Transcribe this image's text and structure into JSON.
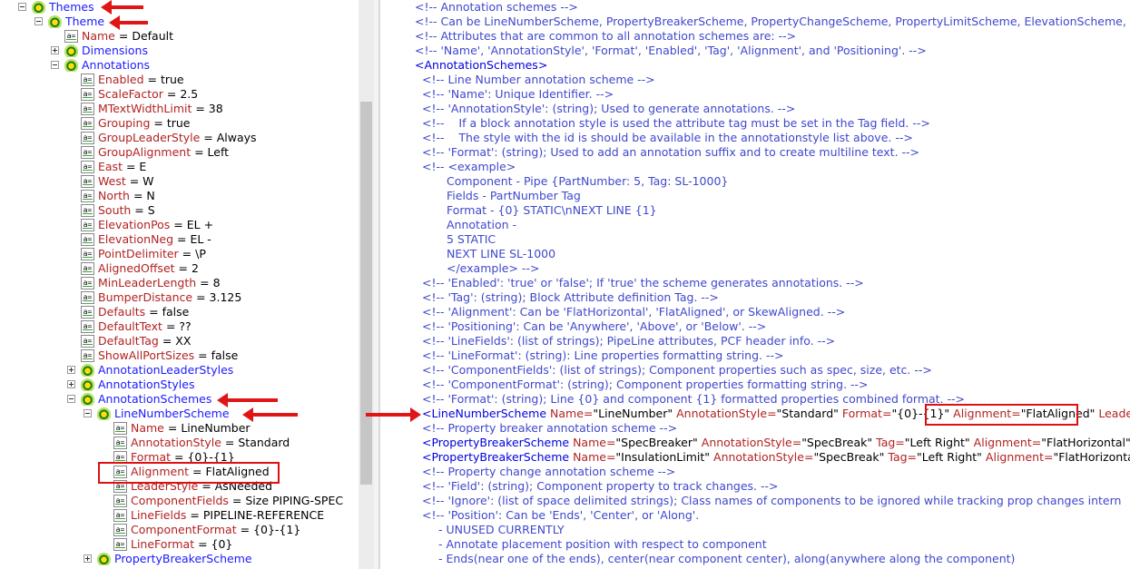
{
  "tree": {
    "root": "Themes",
    "theme": "Theme",
    "name_attr": "Name",
    "name_val": "Default",
    "dimensions": "Dimensions",
    "annotations": "Annotations",
    "annotation_attrs": [
      {
        "k": "Enabled",
        "v": "true"
      },
      {
        "k": "ScaleFactor",
        "v": "2.5"
      },
      {
        "k": "MTextWidthLimit",
        "v": "38"
      },
      {
        "k": "Grouping",
        "v": "true"
      },
      {
        "k": "GroupLeaderStyle",
        "v": "Always"
      },
      {
        "k": "GroupAlignment",
        "v": "Left"
      },
      {
        "k": "East",
        "v": "E"
      },
      {
        "k": "West",
        "v": "W"
      },
      {
        "k": "North",
        "v": "N"
      },
      {
        "k": "South",
        "v": "S"
      },
      {
        "k": "ElevationPos",
        "v": "EL +"
      },
      {
        "k": "ElevationNeg",
        "v": "EL -"
      },
      {
        "k": "PointDelimiter",
        "v": "\\P"
      },
      {
        "k": "AlignedOffset",
        "v": "2"
      },
      {
        "k": "MinLeaderLength",
        "v": "8"
      },
      {
        "k": "BumperDistance",
        "v": "3.125"
      },
      {
        "k": "Defaults",
        "v": "false"
      },
      {
        "k": "DefaultText",
        "v": "??"
      },
      {
        "k": "DefaultTag",
        "v": "XX"
      },
      {
        "k": "ShowAllPortSizes",
        "v": "false"
      }
    ],
    "annotation_leader_styles": "AnnotationLeaderStyles",
    "annotation_styles": "AnnotationStyles",
    "annotation_schemes": "AnnotationSchemes",
    "line_number_scheme": "LineNumberScheme",
    "scheme_attrs": [
      {
        "k": "Name",
        "v": "LineNumber"
      },
      {
        "k": "AnnotationStyle",
        "v": "Standard"
      },
      {
        "k": "Format",
        "v": "{0}-{1}"
      },
      {
        "k": "Alignment",
        "v": "FlatAligned"
      },
      {
        "k": "LeaderStyle",
        "v": "AsNeeded"
      },
      {
        "k": "ComponentFields",
        "v": "Size PIPING-SPEC"
      },
      {
        "k": "LineFields",
        "v": "PIPELINE-REFERENCE"
      },
      {
        "k": "ComponentFormat",
        "v": "{0}-{1}"
      },
      {
        "k": "LineFormat",
        "v": "{0}"
      }
    ],
    "property_breaker_scheme": "PropertyBreakerScheme"
  },
  "xml": {
    "l1": "<!-- Annotation schemes -->",
    "l2": "<!-- Can be LineNumberScheme, PropertyBreakerScheme, PropertyChangeScheme, PropertyLimitScheme, ElevationScheme, Co",
    "l3": "<!-- Attributes that are common to all annotation schemes are: -->",
    "l4": "<!-- 'Name', 'AnnotationStyle', 'Format', 'Enabled', 'Tag', 'Alignment', and 'Positioning'. -->",
    "l5": "<AnnotationSchemes>",
    "l6": "<!-- Line Number annotation scheme -->",
    "l7": "<!-- 'Name': Unique Identifier. -->",
    "l8": "<!-- 'AnnotationStyle': (string); Used to generate annotations. -->",
    "l9": "<!--    If a block annotation style is used the attribute tag must be set in the Tag field. -->",
    "l10": "<!--    The style with the id is should be available in the annotationstyle list above. -->",
    "l11": "<!-- 'Format': (string); Used to add an annotation suffix and to create multiline text. -->",
    "l12": "<!-- <example>",
    "l13": "Component - Pipe {PartNumber: 5, Tag: SL-1000}",
    "l14": "Fields - PartNumber Tag",
    "l15": "Format - {0} STATIC\\nNEXT LINE {1}",
    "l16": "Annotation -",
    "l17": "5 STATIC",
    "l18": "NEXT LINE SL-1000",
    "l19": "</example> -->",
    "l20": "<!-- 'Enabled': 'true' or 'false'; If 'true' the scheme generates annotations. -->",
    "l21": "<!-- 'Tag': (string); Block Attribute definition Tag. -->",
    "l22": "<!-- 'Alignment': Can be 'FlatHorizontal', 'FlatAligned', or SkewAligned. -->",
    "l23": "<!-- 'Positioning': Can be 'Anywhere', 'Above', or 'Below'. -->",
    "l24": "<!-- 'LineFields': (list of strings); PipeLine attributes, PCF header info. -->",
    "l25": "<!-- 'LineFormat': (string): Line properties formatting string. -->",
    "l26": "<!-- 'ComponentFields': (list of strings); Component properties such as spec, size, etc. -->",
    "l27": "<!-- 'ComponentFormat': (string); Component properties formatting string. -->",
    "l28": "<!-- 'Format': (string); Line {0} and component {1} formatted properties combined format. -->",
    "l29_tag": "<LineNumberScheme",
    "l29_a1": "Name=",
    "l29_v1": "\"LineNumber\"",
    "l29_a2": "AnnotationStyle=",
    "l29_v2": "\"Standard\"",
    "l29_a3": "Format=",
    "l29_v3": "\"{0}-{1}\"",
    "l29_a4": "Alignment=",
    "l29_v4": "\"FlatAligned\"",
    "l29_a5": "LeaderSty",
    "l30": "<!-- Property breaker annotation scheme -->",
    "l31_tag": "<PropertyBreakerScheme",
    "l31_a1": "Name=",
    "l31_v1": "\"SpecBreaker\"",
    "l31_a2": "AnnotationStyle=",
    "l31_v2": "\"SpecBreak\"",
    "l31_a3": "Tag=",
    "l31_v3": "\"Left Right\"",
    "l31_a4": "Alignment=",
    "l31_v4": "\"FlatHorizontal\"",
    "l31_a5": "Le",
    "l32_tag": "<PropertyBreakerScheme",
    "l32_a1": "Name=",
    "l32_v1": "\"InsulationLimit\"",
    "l32_a2": "AnnotationStyle=",
    "l32_v2": "\"SpecBreak\"",
    "l32_a3": "Tag=",
    "l32_v3": "\"Left Right\"",
    "l32_a4": "Alignment=",
    "l32_v4": "\"FlatHorizontal\"",
    "l33": "<!-- Property change annotation scheme -->",
    "l34": "<!-- 'Field': (string); Component property to track changes. -->",
    "l35": "<!-- 'Ignore': (list of space delimited strings); Class names of components to be ignored while tracking prop changes intern",
    "l36": "<!-- 'Position': Can be 'Ends', 'Center', or 'Along'.",
    "l37": "- UNUSED CURRENTLY",
    "l38": "- Annotate placement position with respect to component",
    "l39": "- Ends(near one of the ends), center(near component center), along(anywhere along the component)"
  },
  "colors": {
    "element": "#1a1aff",
    "attribute": "#b22222",
    "comment": "#3f48cc",
    "highlight": "#dd1111"
  }
}
